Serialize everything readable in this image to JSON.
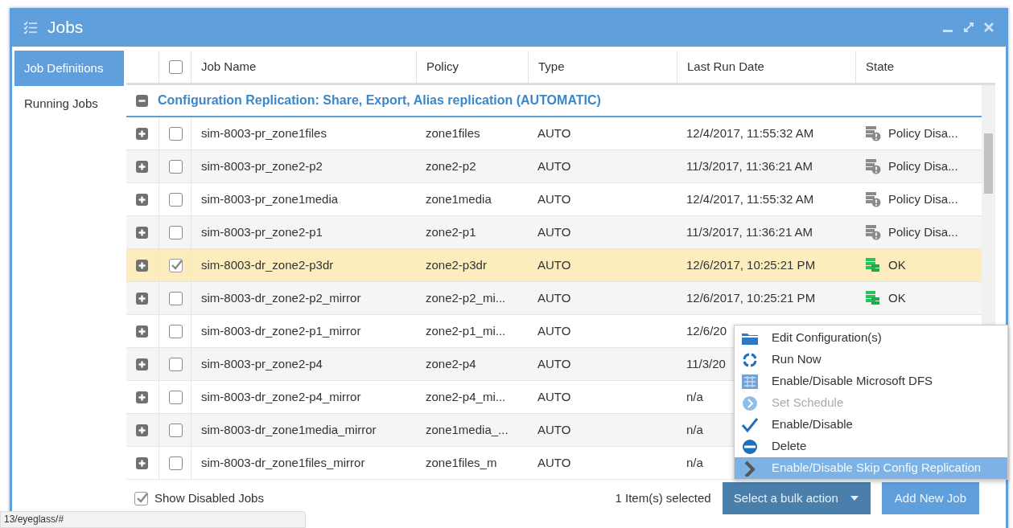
{
  "window": {
    "title": "Jobs"
  },
  "sidebar": {
    "items": [
      {
        "label": "Job Definitions",
        "selected": true
      },
      {
        "label": "Running Jobs",
        "selected": false
      }
    ]
  },
  "table": {
    "select_all_checked": false,
    "columns": [
      "Job Name",
      "Policy",
      "Type",
      "Last Run Date",
      "State"
    ],
    "group": {
      "title": "Configuration Replication: Share, Export, Alias replication (AUTOMATIC)",
      "expanded": true
    },
    "rows": [
      {
        "name": "sim-8003-pr_zone1files",
        "policy": "zone1files",
        "type": "AUTO",
        "last_run": "12/4/2017, 11:55:32 AM",
        "state": {
          "text": "Policy Disa...",
          "kind": "warning"
        },
        "expanded": false,
        "checked": false,
        "selected": false
      },
      {
        "name": "sim-8003-pr_zone2-p2",
        "policy": "zone2-p2",
        "type": "AUTO",
        "last_run": "11/3/2017, 11:36:21 AM",
        "state": {
          "text": "Policy Disa...",
          "kind": "warning"
        },
        "expanded": false,
        "checked": false,
        "selected": false
      },
      {
        "name": "sim-8003-pr_zone1media",
        "policy": "zone1media",
        "type": "AUTO",
        "last_run": "12/4/2017, 11:55:32 AM",
        "state": {
          "text": "Policy Disa...",
          "kind": "warning"
        },
        "expanded": false,
        "checked": false,
        "selected": false
      },
      {
        "name": "sim-8003-pr_zone2-p1",
        "policy": "zone2-p1",
        "type": "AUTO",
        "last_run": "11/3/2017, 11:36:21 AM",
        "state": {
          "text": "Policy Disa...",
          "kind": "warning"
        },
        "expanded": false,
        "checked": false,
        "selected": false
      },
      {
        "name": "sim-8003-dr_zone2-p3dr",
        "policy": "zone2-p3dr",
        "type": "AUTO",
        "last_run": "12/6/2017, 10:25:21 PM",
        "state": {
          "text": "OK",
          "kind": "ok"
        },
        "expanded": false,
        "checked": true,
        "selected": true
      },
      {
        "name": "sim-8003-dr_zone2-p2_mirror",
        "policy": "zone2-p2_mi...",
        "type": "AUTO",
        "last_run": "12/6/2017, 10:25:21 PM",
        "state": {
          "text": "OK",
          "kind": "ok"
        },
        "expanded": false,
        "checked": false,
        "selected": false
      },
      {
        "name": "sim-8003-dr_zone2-p1_mirror",
        "policy": "zone2-p1_mi...",
        "type": "AUTO",
        "last_run": "12/6/20",
        "expanded": false,
        "checked": false,
        "selected": false
      },
      {
        "name": "sim-8003-pr_zone2-p4",
        "policy": "zone2-p4",
        "type": "AUTO",
        "last_run": "11/3/20",
        "expanded": false,
        "checked": false,
        "selected": false
      },
      {
        "name": "sim-8003-dr_zone2-p4_mirror",
        "policy": "zone2-p4_mi...",
        "type": "AUTO",
        "last_run": "n/a",
        "expanded": false,
        "checked": false,
        "selected": false
      },
      {
        "name": "sim-8003-dr_zone1media_mirror",
        "policy": "zone1media_...",
        "type": "AUTO",
        "last_run": "n/a",
        "expanded": false,
        "checked": false,
        "selected": false
      },
      {
        "name": "sim-8003-dr_zone1files_mirror",
        "policy": "zone1files_m",
        "type": "AUTO",
        "last_run": "n/a",
        "expanded": false,
        "checked": false,
        "selected": false
      }
    ]
  },
  "footer": {
    "show_disabled": {
      "label": "Show Disabled Jobs",
      "checked": true
    },
    "selection_count": "1 Item(s) selected",
    "bulk_button": "Select a bulk action",
    "add_button": "Add New Job"
  },
  "bulk_menu": {
    "items": [
      {
        "label": "Edit Configuration(s)",
        "disabled": false,
        "selected": false
      },
      {
        "label": "Run Now",
        "disabled": false,
        "selected": false
      },
      {
        "label": "Enable/Disable Microsoft DFS",
        "disabled": false,
        "selected": false
      },
      {
        "label": "Set Schedule",
        "disabled": true,
        "selected": false
      },
      {
        "label": "Enable/Disable",
        "disabled": false,
        "selected": false
      },
      {
        "label": "Delete",
        "disabled": false,
        "selected": false
      },
      {
        "label": "Enable/Disable Skip Config Replication",
        "disabled": false,
        "selected": true
      }
    ]
  },
  "status_bar": {
    "url": "13/eyeglass/#"
  }
}
